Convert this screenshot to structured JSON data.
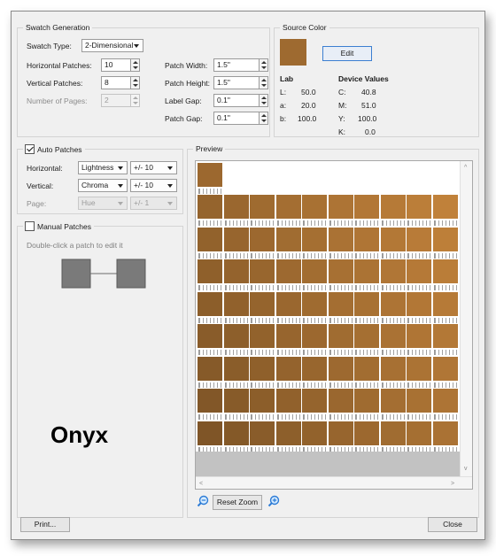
{
  "swatch_generation": {
    "title": "Swatch Generation",
    "swatch_type_label": "Swatch Type:",
    "swatch_type_value": "2-Dimensional",
    "horizontal_patches_label": "Horizontal Patches:",
    "horizontal_patches_value": "10",
    "vertical_patches_label": "Vertical Patches:",
    "vertical_patches_value": "8",
    "number_of_pages_label": "Number of Pages:",
    "number_of_pages_value": "2",
    "patch_width_label": "Patch Width:",
    "patch_width_value": "1.5\"",
    "patch_height_label": "Patch Height:",
    "patch_height_value": "1.5\"",
    "label_gap_label": "Label Gap:",
    "label_gap_value": "0.1\"",
    "patch_gap_label": "Patch Gap:",
    "patch_gap_value": "0.1\""
  },
  "source_color": {
    "title": "Source Color",
    "edit_label": "Edit",
    "swatch_color": "#9e6a30",
    "lab_heading": "Lab",
    "device_heading": "Device Values",
    "lab": [
      {
        "key": "L:",
        "value": "50.0"
      },
      {
        "key": "a:",
        "value": "20.0"
      },
      {
        "key": "b:",
        "value": "100.0"
      }
    ],
    "device": [
      {
        "key": "C:",
        "value": "40.8"
      },
      {
        "key": "M:",
        "value": "51.0"
      },
      {
        "key": "Y:",
        "value": "100.0"
      },
      {
        "key": "K:",
        "value": "0.0"
      }
    ]
  },
  "auto_patches": {
    "label": "Auto Patches",
    "checked": true,
    "horizontal_label": "Horizontal:",
    "horizontal_attr": "Lightness",
    "horizontal_range": "+/- 10",
    "vertical_label": "Vertical:",
    "vertical_attr": "Chroma",
    "vertical_range": "+/- 10",
    "page_label": "Page:",
    "page_attr": "Hue",
    "page_range": "+/- 1"
  },
  "manual_patches": {
    "label": "Manual Patches",
    "checked": false,
    "hint": "Double-click a patch to edit it"
  },
  "preview": {
    "title": "Preview",
    "reset_zoom_label": "Reset Zoom",
    "rows": 9,
    "cols": 10,
    "base_color": "#9e6a30"
  },
  "footer": {
    "print_label": "Print...",
    "close_label": "Close"
  },
  "watermark": "Onyx",
  "colors": {
    "accent_border": "#3c7fd1",
    "patch_grey": "#7a7a7a"
  }
}
